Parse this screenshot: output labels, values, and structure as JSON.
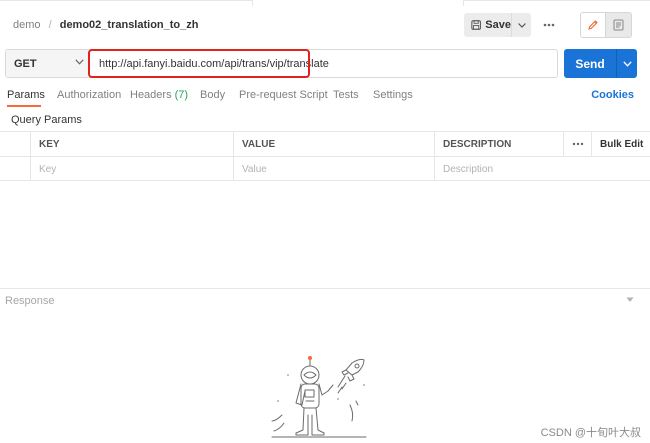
{
  "breadcrumb": {
    "parent": "demo",
    "separator": "/",
    "current": "demo02_translation_to_zh"
  },
  "header": {
    "save_label": "Save"
  },
  "request": {
    "method": "GET",
    "url": "http://api.fanyi.baidu.com/api/trans/vip/translate",
    "send_label": "Send"
  },
  "tabs": {
    "params": "Params",
    "authorization": "Authorization",
    "headers": "Headers",
    "headers_count": "(7)",
    "body": "Body",
    "pre_request": "Pre-request Script",
    "tests": "Tests",
    "settings": "Settings",
    "cookies": "Cookies"
  },
  "query_params": {
    "title": "Query Params",
    "columns": {
      "key": "KEY",
      "value": "VALUE",
      "description": "DESCRIPTION",
      "bulk_edit": "Bulk Edit"
    },
    "placeholders": {
      "key": "Key",
      "value": "Value",
      "description": "Description"
    }
  },
  "response": {
    "title": "Response"
  },
  "watermark": "CSDN @十旬叶大叔",
  "colors": {
    "accent": "#1a73d6",
    "highlight": "#e0231b",
    "active_tab": "#f26b3a",
    "count": "#26a65b"
  }
}
